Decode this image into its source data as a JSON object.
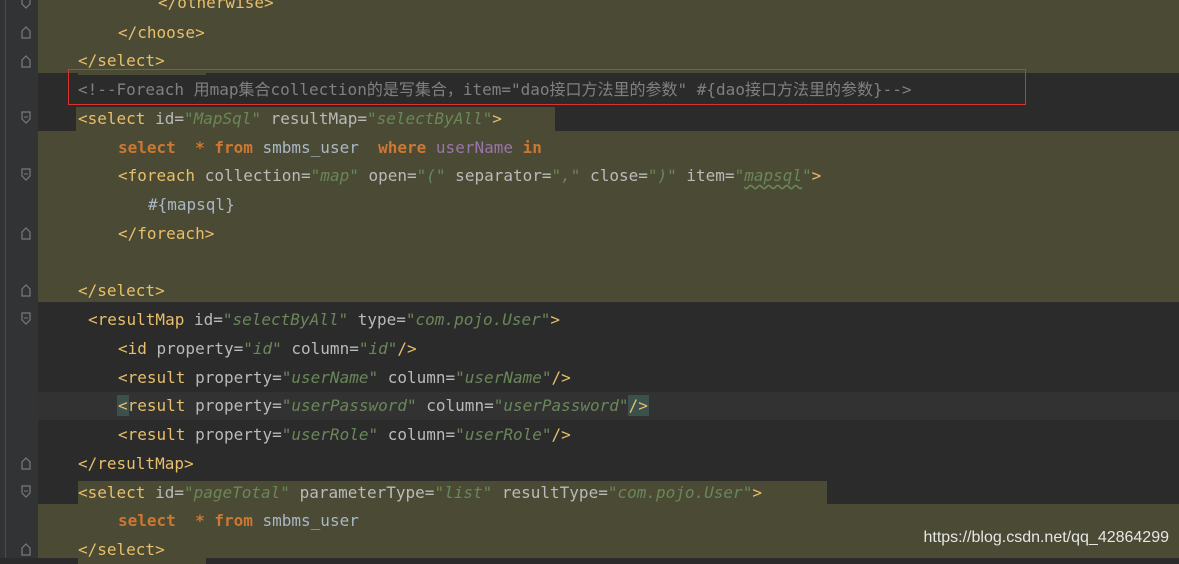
{
  "editor": {
    "lines": [
      {
        "tokens": [
          {
            "c": "t",
            "s": "</otherwise>"
          }
        ]
      },
      {
        "tokens": [
          {
            "c": "t",
            "s": "</choose>"
          }
        ]
      },
      {
        "tokens": [
          {
            "c": "t",
            "s": "</select>"
          }
        ]
      },
      {
        "tokens": [
          {
            "c": "c",
            "s": "<!--Foreach 用map集合collection的是写集合，item=\"dao接口方法里的参数\" #{dao接口方法里的参数}-->"
          }
        ]
      },
      {
        "tokens": [
          {
            "c": "t",
            "s": "<select "
          },
          {
            "c": "a",
            "s": "id="
          },
          {
            "c": "v",
            "s": "\"MapSql\""
          },
          {
            "c": "a",
            "s": " resultMap="
          },
          {
            "c": "v",
            "s": "\"selectByAll\""
          },
          {
            "c": "t",
            "s": ">"
          }
        ]
      },
      {
        "tokens": [
          {
            "c": "k",
            "s": "select"
          },
          {
            "c": "x",
            "s": "  "
          },
          {
            "c": "k",
            "s": "*"
          },
          {
            "c": "x",
            "s": " "
          },
          {
            "c": "k",
            "s": "from"
          },
          {
            "c": "x",
            "s": " smbms_user  "
          },
          {
            "c": "k",
            "s": "where"
          },
          {
            "c": "x",
            "s": " "
          },
          {
            "c": "p",
            "s": "userName"
          },
          {
            "c": "x",
            "s": " "
          },
          {
            "c": "k",
            "s": "in"
          }
        ]
      },
      {
        "tokens": [
          {
            "c": "t",
            "s": "<foreach "
          },
          {
            "c": "a",
            "s": "collection="
          },
          {
            "c": "v",
            "s": "\"map\""
          },
          {
            "c": "a",
            "s": " open="
          },
          {
            "c": "v",
            "s": "\"(\""
          },
          {
            "c": "a",
            "s": " separator="
          },
          {
            "c": "v",
            "s": "\",\""
          },
          {
            "c": "a",
            "s": " close="
          },
          {
            "c": "v",
            "s": "\")\""
          },
          {
            "c": "a",
            "s": " item="
          },
          {
            "c": "v",
            "s": "\""
          },
          {
            "c": "vs",
            "s": "mapsql"
          },
          {
            "c": "v",
            "s": "\""
          },
          {
            "c": "t",
            "s": ">"
          }
        ]
      },
      {
        "tokens": [
          {
            "c": "x",
            "s": "#{mapsql}"
          }
        ]
      },
      {
        "tokens": [
          {
            "c": "t",
            "s": "</foreach>"
          }
        ]
      },
      {
        "tokens": []
      },
      {
        "tokens": [
          {
            "c": "t",
            "s": "</select>"
          }
        ]
      },
      {
        "tokens": [
          {
            "c": "t",
            "s": "<resultMap "
          },
          {
            "c": "a",
            "s": "id="
          },
          {
            "c": "v",
            "s": "\"selectByAll\""
          },
          {
            "c": "a",
            "s": " type="
          },
          {
            "c": "v",
            "s": "\"com.pojo.User\""
          },
          {
            "c": "t",
            "s": ">"
          }
        ]
      },
      {
        "tokens": [
          {
            "c": "t",
            "s": "<id "
          },
          {
            "c": "a",
            "s": "property="
          },
          {
            "c": "v",
            "s": "\"id\""
          },
          {
            "c": "a",
            "s": " column="
          },
          {
            "c": "v",
            "s": "\"id\""
          },
          {
            "c": "t",
            "s": "/>"
          }
        ]
      },
      {
        "tokens": [
          {
            "c": "t",
            "s": "<result "
          },
          {
            "c": "a",
            "s": "property="
          },
          {
            "c": "v",
            "s": "\"userName\""
          },
          {
            "c": "a",
            "s": " column="
          },
          {
            "c": "v",
            "s": "\"userName\""
          },
          {
            "c": "t",
            "s": "/>"
          }
        ]
      },
      {
        "tokens": [
          {
            "c": "tm",
            "s": "<"
          },
          {
            "c": "t",
            "s": "result "
          },
          {
            "c": "a",
            "s": "property="
          },
          {
            "c": "v",
            "s": "\"userPassword\""
          },
          {
            "c": "a",
            "s": " column="
          },
          {
            "c": "v",
            "s": "\"userPassword\""
          },
          {
            "c": "tm",
            "s": "/>"
          }
        ]
      },
      {
        "tokens": [
          {
            "c": "t",
            "s": "<result "
          },
          {
            "c": "a",
            "s": "property="
          },
          {
            "c": "v",
            "s": "\"userRole\""
          },
          {
            "c": "a",
            "s": " column="
          },
          {
            "c": "v",
            "s": "\"userRole\""
          },
          {
            "c": "t",
            "s": "/>"
          }
        ]
      },
      {
        "tokens": [
          {
            "c": "t",
            "s": "</resultMap>"
          }
        ]
      },
      {
        "tokens": [
          {
            "c": "t",
            "s": "<select "
          },
          {
            "c": "a",
            "s": "id="
          },
          {
            "c": "v",
            "s": "\"pageTotal\""
          },
          {
            "c": "a",
            "s": " parameterType="
          },
          {
            "c": "v",
            "s": "\"list\""
          },
          {
            "c": "a",
            "s": " resultType="
          },
          {
            "c": "v",
            "s": "\"com.pojo.User\""
          },
          {
            "c": "t",
            "s": ">"
          }
        ]
      },
      {
        "tokens": [
          {
            "c": "k",
            "s": "select"
          },
          {
            "c": "x",
            "s": "  "
          },
          {
            "c": "k",
            "s": "*"
          },
          {
            "c": "x",
            "s": " "
          },
          {
            "c": "k",
            "s": "from"
          },
          {
            "c": "x",
            "s": " smbms_user"
          }
        ]
      },
      {
        "tokens": [
          {
            "c": "t",
            "s": "</select>"
          }
        ]
      }
    ]
  },
  "watermark": "https://blog.csdn.net/qq_42864299",
  "colors": {
    "background": "#2b2b2b",
    "gutter": "#313335",
    "highlight": "#4b4a34",
    "tag": "#e8bf6a",
    "keyword": "#cc7832",
    "string": "#6a8759",
    "comment": "#808080",
    "annotation_box": "#d9342b"
  }
}
